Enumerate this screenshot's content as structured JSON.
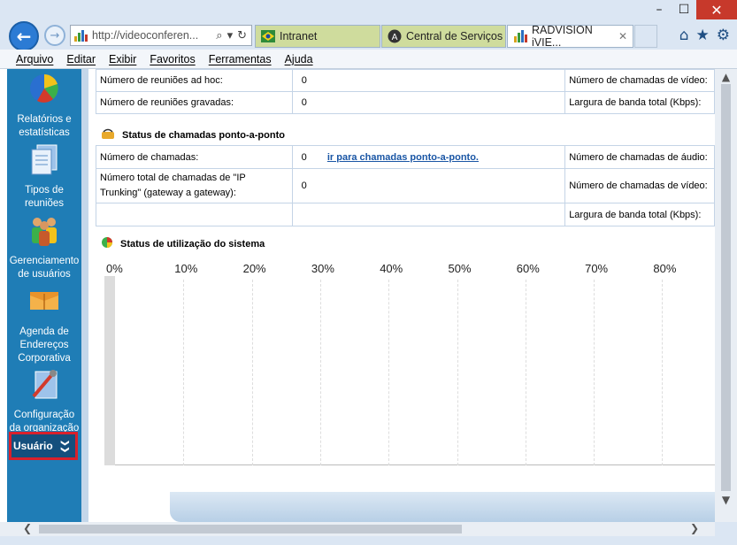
{
  "browser": {
    "window_controls": {
      "minimize": "–",
      "maximize": "☐",
      "close": "✕"
    },
    "back_glyph": "←",
    "forward_glyph": "→",
    "address": {
      "url": "http://videoconferen...",
      "search_glyph": "⌕",
      "dropdown_glyph": "▾",
      "refresh_glyph": "↻"
    },
    "tabs": [
      {
        "label": "Intranet"
      },
      {
        "label": "Central de Serviços",
        "icon_letter": "A"
      },
      {
        "label": "RADVISION iVIE...",
        "close_glyph": "✕"
      }
    ],
    "right_icons": {
      "home": "⌂",
      "favorites": "★",
      "settings": "⚙"
    },
    "menu": [
      "Arquivo",
      "Editar",
      "Exibir",
      "Favoritos",
      "Ferramentas",
      "Ajuda"
    ]
  },
  "sidebar": {
    "items": [
      {
        "label": "Relatórios e estatísticas",
        "icon": "pie-chart-icon"
      },
      {
        "label": "Tipos de reuniões",
        "icon": "documents-icon"
      },
      {
        "label": "Gerenciamento de usuários",
        "icon": "users-icon"
      },
      {
        "label": "Agenda de Endereços Corporativa",
        "icon": "address-book-icon"
      },
      {
        "label": "Configuração da organização",
        "icon": "tools-icon"
      }
    ],
    "user": {
      "label": "Usuário",
      "chevron": "❯❯"
    }
  },
  "meetings_table": {
    "rows": [
      {
        "label": "Número de reuniões ad hoc:",
        "value": "0",
        "right_label": "Número de chamadas de vídeo:"
      },
      {
        "label": "Número de reuniões gravadas:",
        "value": "0",
        "right_label": "Largura de banda total (Kbps):"
      }
    ]
  },
  "p2p": {
    "title": "Status de chamadas ponto-a-ponto",
    "rows": [
      {
        "label": "Número de chamadas:",
        "value": "0",
        "link": "ir para chamadas ponto-a-ponto.",
        "right_label": "Número de chamadas de áudio:"
      },
      {
        "label": "Número total de chamadas de \"IP Trunking\" (gateway a gateway):",
        "value": "0",
        "right_label": "Número de chamadas de vídeo:"
      },
      {
        "label": "",
        "value": "",
        "right_label": "Largura de banda total (Kbps):"
      }
    ]
  },
  "usage": {
    "title": "Status de utilização do sistema"
  },
  "chart_data": {
    "type": "bar",
    "title": "Status de utilização do sistema",
    "x_ticks": [
      "0%",
      "10%",
      "20%",
      "30%",
      "40%",
      "50%",
      "60%",
      "70%",
      "80%"
    ],
    "xlim": [
      0,
      90
    ],
    "categories": [],
    "values": []
  },
  "scrollbars": {
    "up": "▲",
    "down": "▼",
    "left": "❮",
    "right": "❯"
  }
}
